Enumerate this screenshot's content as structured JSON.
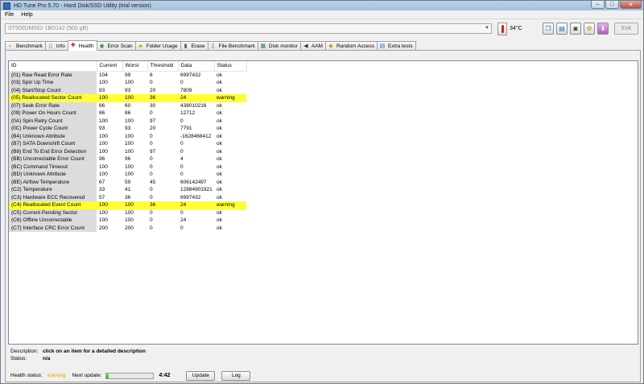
{
  "window": {
    "title": "HD Tune Pro 5.70 - Hard Disk/SSD Utility (trial version)"
  },
  "window_controls": {
    "minimize": "–",
    "maximize": "□",
    "close": "✕"
  },
  "menu": [
    "File",
    "Help"
  ],
  "toolbar": {
    "drive": "ST500DM002-1BD142 (500 gB)",
    "temperature": "34°C",
    "exit_label": "Exit",
    "icons": [
      "copy-icon",
      "paste-icon",
      "camera-icon",
      "options-icon",
      "download-icon"
    ]
  },
  "tabs": [
    {
      "label": "Benchmark",
      "icon": "benchmark-icon"
    },
    {
      "label": "Info",
      "icon": "info-icon"
    },
    {
      "label": "Health",
      "icon": "health-icon"
    },
    {
      "label": "Error Scan",
      "icon": "error-scan-icon"
    },
    {
      "label": "Folder Usage",
      "icon": "folder-icon"
    },
    {
      "label": "Erase",
      "icon": "erase-icon"
    },
    {
      "label": "File Benchmark",
      "icon": "file-benchmark-icon"
    },
    {
      "label": "Disk monitor",
      "icon": "disk-monitor-icon"
    },
    {
      "label": "AAM",
      "icon": "aam-icon"
    },
    {
      "label": "Random Access",
      "icon": "random-access-icon"
    },
    {
      "label": "Extra tests",
      "icon": "extra-tests-icon"
    }
  ],
  "active_tab": "Health",
  "table": {
    "headers": [
      "ID",
      "Current",
      "Worst",
      "Threshold",
      "Data",
      "Status"
    ],
    "rows": [
      [
        "(01) Raw Read Error Rate",
        "104",
        "99",
        "6",
        "6997432",
        "ok"
      ],
      [
        "(03) Spin Up Time",
        "100",
        "100",
        "0",
        "0",
        "ok"
      ],
      [
        "(04) Start/Stop Count",
        "93",
        "93",
        "20",
        "7809",
        "ok"
      ],
      [
        "(05) Reallocated Sector Count",
        "100",
        "100",
        "36",
        "24",
        "warning"
      ],
      [
        "(07) Seek Error Rate",
        "86",
        "60",
        "30",
        "438010216",
        "ok"
      ],
      [
        "(09) Power On Hours Count",
        "86",
        "86",
        "0",
        "12712",
        "ok"
      ],
      [
        "(0A) Spin Retry Count",
        "100",
        "100",
        "97",
        "0",
        "ok"
      ],
      [
        "(0C) Power Cycle Count",
        "93",
        "93",
        "20",
        "7791",
        "ok"
      ],
      [
        "(B4) Unknown Attribute",
        "100",
        "100",
        "0",
        "-1628468412",
        "ok"
      ],
      [
        "(B7) SATA Downshift Count",
        "100",
        "100",
        "0",
        "0",
        "ok"
      ],
      [
        "(B8) End To End Error Detection",
        "100",
        "100",
        "97",
        "0",
        "ok"
      ],
      [
        "(BB) Uncorrectable Error Count",
        "96",
        "96",
        "0",
        "4",
        "ok"
      ],
      [
        "(BC) Command Timeout",
        "100",
        "100",
        "0",
        "0",
        "ok"
      ],
      [
        "(BD) Unknown Attribute",
        "100",
        "100",
        "0",
        "0",
        "ok"
      ],
      [
        "(BE) Airflow Temperature",
        "67",
        "59",
        "45",
        "606142497",
        "ok"
      ],
      [
        "(C2) Temperature",
        "33",
        "41",
        "0",
        "12884901921",
        "ok"
      ],
      [
        "(C3) Hardware ECC Recovered",
        "57",
        "36",
        "0",
        "6997432",
        "ok"
      ],
      [
        "(C4) Reallocated Event Count",
        "100",
        "100",
        "36",
        "24",
        "warning"
      ],
      [
        "(C5) Current Pending Sector",
        "100",
        "100",
        "0",
        "0",
        "ok"
      ],
      [
        "(C6) Offline Uncorrectable",
        "100",
        "100",
        "0",
        "24",
        "ok"
      ],
      [
        "(C7) Interface CRC Error Count",
        "200",
        "200",
        "0",
        "0",
        "ok"
      ]
    ]
  },
  "description": {
    "label": "Description:",
    "value": "click on an item for a detailed description"
  },
  "status": {
    "label": "Status:",
    "value": "n/a"
  },
  "footer": {
    "health_label": "Health status:",
    "health_value": "warning",
    "next_update_label": "Next update:",
    "next_update_progress": 0.05,
    "next_update_time": "4:42",
    "update_label": "Update",
    "log_label": "Log"
  },
  "colors": {
    "warning_row": "#ffff33",
    "warning_text": "#e6a000",
    "progress_fill": "#3ea62c"
  }
}
